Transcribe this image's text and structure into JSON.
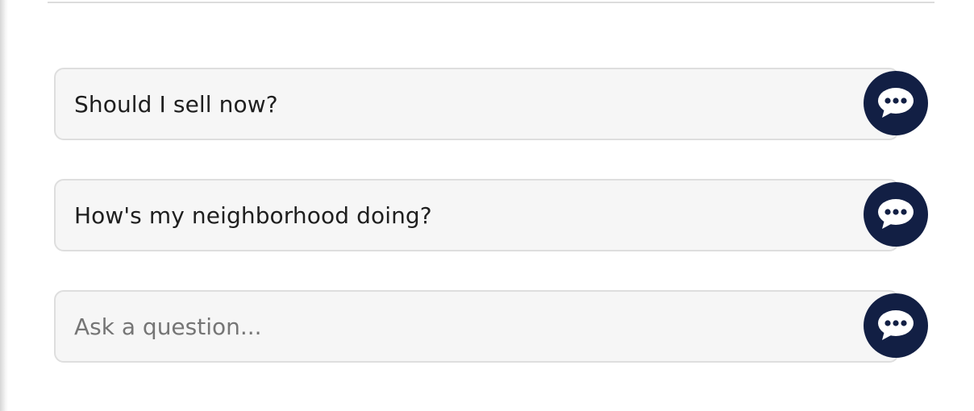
{
  "prompts": {
    "items": [
      {
        "label": "Should I sell now?",
        "icon": "chat-bubble-icon"
      },
      {
        "label": "How's my neighborhood doing?",
        "icon": "chat-bubble-icon"
      }
    ],
    "question_input": {
      "value": "",
      "placeholder": "Ask a question...",
      "icon": "chat-bubble-icon"
    }
  },
  "colors": {
    "accent": "#121f44",
    "box_background": "#f6f6f6",
    "box_border": "#dedede",
    "text": "#1f1f1f",
    "placeholder": "#757575"
  }
}
